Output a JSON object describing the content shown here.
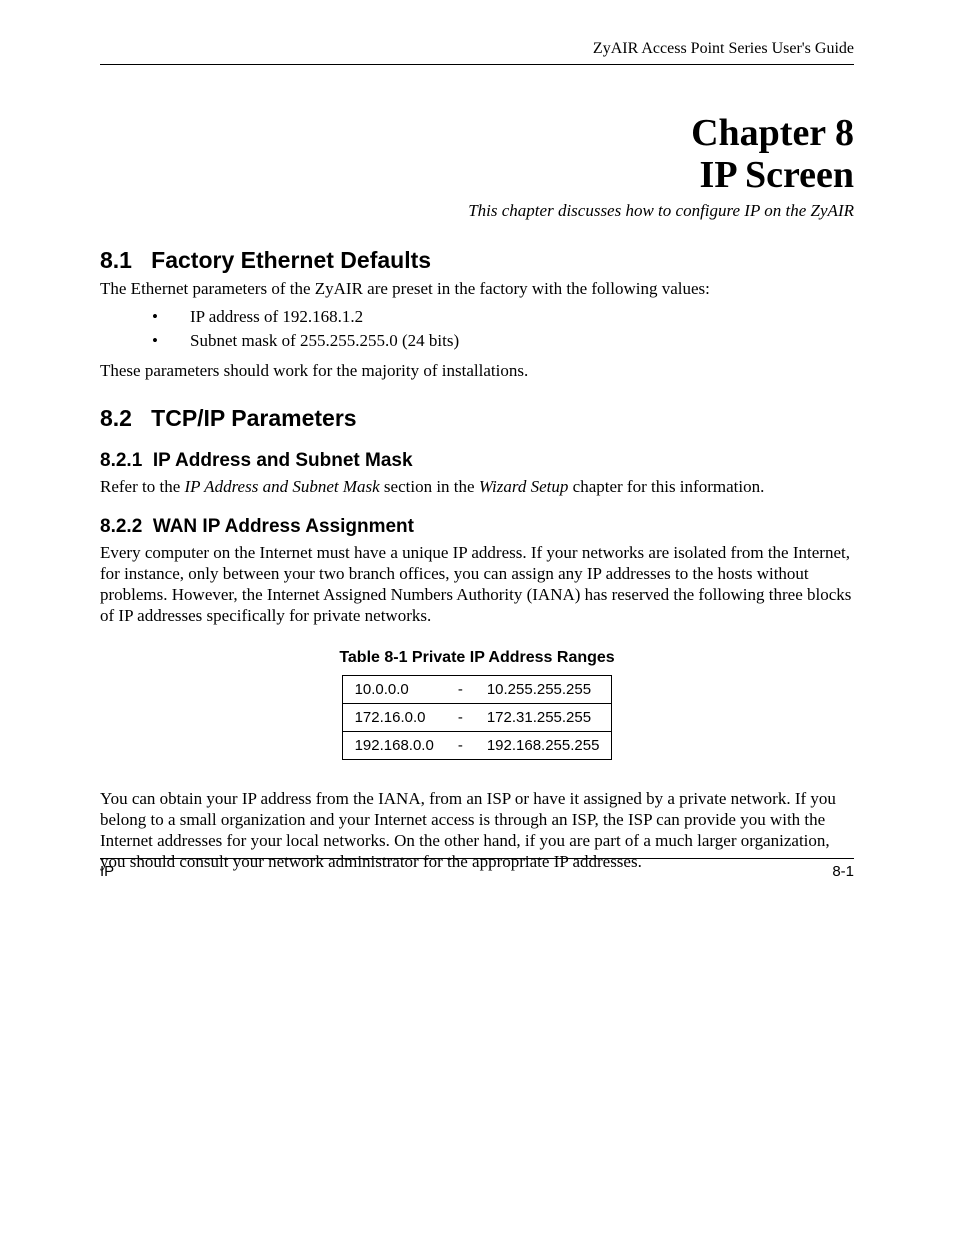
{
  "header": {
    "running_title": "ZyAIR Access Point Series User's Guide"
  },
  "chapter": {
    "line1": "Chapter 8",
    "line2": "IP Screen",
    "subtitle": "This chapter discusses how to configure IP on the ZyAIR"
  },
  "sec_8_1": {
    "num": "8.1",
    "title": "Factory Ethernet Defaults",
    "intro": "The Ethernet parameters of the ZyAIR are preset in the factory with the following values:",
    "bullets": [
      "IP address of 192.168.1.2",
      "Subnet mask of 255.255.255.0 (24 bits)"
    ],
    "outro": "These parameters should work for the majority of installations."
  },
  "sec_8_2": {
    "num": "8.2",
    "title": "TCP/IP Parameters"
  },
  "sec_8_2_1": {
    "num": "8.2.1",
    "title": "IP Address and Subnet Mask",
    "text_pre": "Refer to the ",
    "text_ital1": "IP Address and Subnet Mask",
    "text_mid": " section in the ",
    "text_ital2": "Wizard Setup",
    "text_post": " chapter for this information."
  },
  "sec_8_2_2": {
    "num": "8.2.2",
    "title": "WAN IP Address Assignment",
    "para1": "Every computer on the Internet must have a unique IP address. If your networks are isolated from the Internet, for instance, only between your two branch offices, you can assign any IP addresses to the hosts without problems. However, the Internet Assigned Numbers Authority (IANA) has reserved the following three blocks of IP addresses specifically for private networks.",
    "table_caption": "Table 8-1 Private IP Address Ranges",
    "rows": [
      {
        "start": "10.0.0.0",
        "dash": "-",
        "end": "10.255.255.255"
      },
      {
        "start": "172.16.0.0",
        "dash": "-",
        "end": "172.31.255.255"
      },
      {
        "start": "192.168.0.0",
        "dash": "-",
        "end": "192.168.255.255"
      }
    ],
    "para2": "You can obtain your IP address from the IANA, from an ISP or have it assigned by a private network. If you belong to a small organization and your Internet access is through an ISP, the ISP can provide you with the Internet addresses for your local networks. On the other hand, if you are part of a much larger organization, you should consult your network administrator for the appropriate IP addresses."
  },
  "footer": {
    "left": "IP",
    "right": "8-1"
  }
}
